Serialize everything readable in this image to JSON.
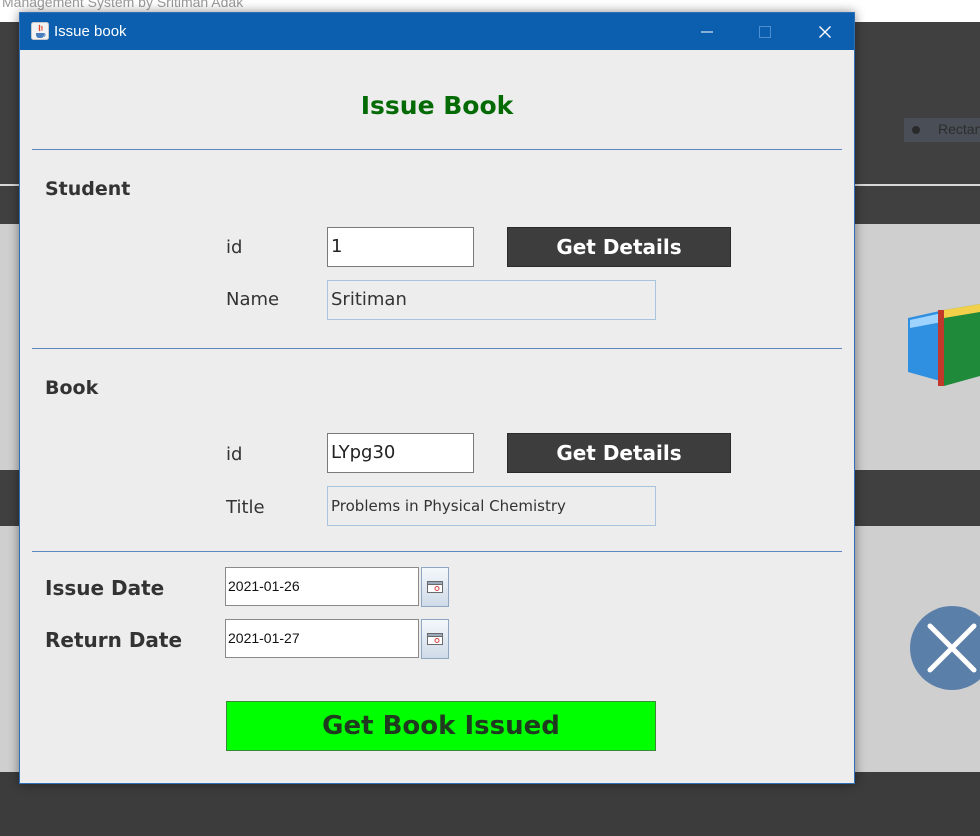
{
  "background_app": {
    "title_text": "Management System by Sritiman Adak",
    "toolbar_item": "Rectangle"
  },
  "dialog": {
    "title": "Issue book",
    "heading": "Issue Book"
  },
  "student": {
    "section_label": "Student",
    "id_label": "id",
    "id_value": "1",
    "name_label": "Name",
    "name_value": "Sritiman",
    "details_button": "Get Details"
  },
  "book": {
    "section_label": "Book",
    "id_label": "id",
    "id_value": "LYpg30",
    "title_label": "Title",
    "title_value": "Problems in Physical Chemistry",
    "details_button": "Get Details"
  },
  "dates": {
    "issue_label": "Issue Date",
    "issue_value": "2021-01-26",
    "return_label": "Return Date",
    "return_value": "2021-01-27"
  },
  "actions": {
    "issue_button": "Get Book Issued"
  },
  "colors": {
    "titlebar": "#0b5fae",
    "heading": "#046a04",
    "details_button": "#3d3d3d",
    "issue_button": "#00ff00"
  },
  "icons": {
    "app": "java-icon",
    "minimize": "minimize-icon",
    "maximize": "maximize-icon",
    "close": "close-icon",
    "calendar": "calendar-icon",
    "background_book": "book-icon",
    "background_close": "close-circle-icon"
  }
}
